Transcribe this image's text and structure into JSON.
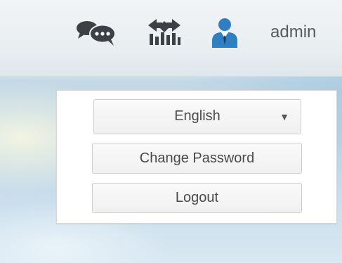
{
  "header": {
    "icons": [
      "messages-icon",
      "monitor-chart-icon",
      "user-icon"
    ],
    "username": "admin"
  },
  "user_menu": {
    "language": {
      "selected": "English",
      "arrow": "▼"
    },
    "change_password_label": "Change Password",
    "logout_label": "Logout"
  },
  "colors": {
    "icon_dark": "#3d4044",
    "icon_blue": "#2f7fc1",
    "text": "#555a5e",
    "button_border": "#cfcfcf"
  }
}
